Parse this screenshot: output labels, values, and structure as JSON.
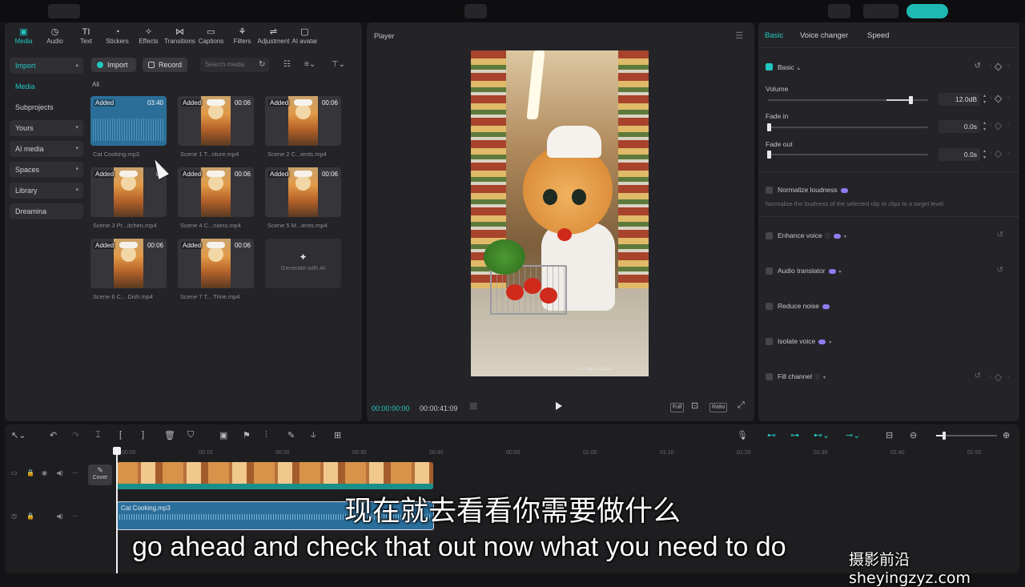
{
  "media_tools": [
    {
      "label": "Media",
      "icon": "media-icon",
      "glyph": "▣",
      "active": true
    },
    {
      "label": "Audio",
      "icon": "audio-icon",
      "glyph": "◷"
    },
    {
      "label": "Text",
      "icon": "text-icon",
      "glyph": "TI"
    },
    {
      "label": "Stickers",
      "icon": "stickers-icon",
      "glyph": "◔"
    },
    {
      "label": "Effects",
      "icon": "effects-icon",
      "glyph": "✧"
    },
    {
      "label": "Transitions",
      "icon": "transitions-icon",
      "glyph": "⋈"
    },
    {
      "label": "Captions",
      "icon": "captions-icon",
      "glyph": "▭"
    },
    {
      "label": "Filters",
      "icon": "filters-icon",
      "glyph": "⚘"
    },
    {
      "label": "Adjustment",
      "icon": "adjustment-icon",
      "glyph": "⇌"
    },
    {
      "label": "AI avatar",
      "icon": "ai-avatar-icon",
      "glyph": "▢"
    }
  ],
  "sidebar": [
    {
      "label": "Import",
      "boxed": true,
      "caret": true,
      "green": true
    },
    {
      "label": "Media",
      "green": true
    },
    {
      "label": "Subprojects"
    },
    {
      "label": "Yours",
      "boxed": true,
      "caret": true
    },
    {
      "label": "AI media",
      "boxed": true,
      "caret": true
    },
    {
      "label": "Spaces",
      "boxed": true,
      "caret": true
    },
    {
      "label": "Library",
      "boxed": true,
      "caret": true
    },
    {
      "label": "Dreamina",
      "boxed": true
    }
  ],
  "media_toolbar": {
    "import_label": "Import",
    "record_label": "Record",
    "search_placeholder": "Search media"
  },
  "all_label": "All",
  "media_items": [
    {
      "name": "Cat Cooking.mp3",
      "badge": "Added",
      "duration": "03:40",
      "type": "audio"
    },
    {
      "name": "Scene 1 T...nture.mp4",
      "badge": "Added",
      "duration": "00:06",
      "type": "video"
    },
    {
      "name": "Scene 2 C...ients.mp4",
      "badge": "Added",
      "duration": "00:06",
      "type": "video"
    },
    {
      "name": "Scene 3 Pr...itchen.mp4",
      "badge": "Added",
      "duration": "00",
      "type": "video"
    },
    {
      "name": "Scene 4 C...nions.mp4",
      "badge": "Added",
      "duration": "00:06",
      "type": "video"
    },
    {
      "name": "Scene 5 M...ients.mp4",
      "badge": "Added",
      "duration": "00:06",
      "type": "video"
    },
    {
      "name": "Scene 6 C... Dish.mp4",
      "badge": "Added",
      "duration": "00:06",
      "type": "video"
    },
    {
      "name": "Scene 7 T... Time.mp4",
      "badge": "Added",
      "duration": "00:06",
      "type": "video"
    }
  ],
  "generate_label": "Generate with AI",
  "player": {
    "title": "Player",
    "current_time": "00:00:00:00",
    "total_time": "00:00:41:09",
    "full_label": "Full",
    "ratio_label": "Ratio",
    "watermark": "♪ TikTok ▶ CapCut"
  },
  "props": {
    "tabs": [
      {
        "label": "Basic",
        "active": true
      },
      {
        "label": "Voice changer"
      },
      {
        "label": "Speed"
      }
    ],
    "basic_label": "Basic",
    "volume_label": "Volume",
    "volume_value": "12.0dB",
    "volume_level": 0.89,
    "fade_in_label": "Fade in",
    "fade_in_value": "0.0s",
    "fade_out_label": "Fade out",
    "fade_out_value": "0.0s",
    "normalize_label": "Normalize loudness",
    "normalize_desc": "Normalize the loudness of the selected clip or clips to a target level.",
    "enhance_label": "Enhance voice",
    "translator_label": "Audio translator",
    "reduce_label": "Reduce noise",
    "isolate_label": "Isolate voice",
    "fill_label": "Fill channel"
  },
  "timeline": {
    "ticks": [
      "00:00",
      "00:10",
      "00:20",
      "00:30",
      "00:40",
      "00:50",
      "01:00",
      "01:10",
      "01:20",
      "01:30",
      "01:40",
      "01:50"
    ],
    "cover_label": "Cover",
    "audio_clip_label": "Cat Cooking.mp3",
    "zoom_level": 0.13
  },
  "subtitles": {
    "zh": "现在就去看看你需要做什么",
    "en": "go ahead and check that out now what you need to do"
  },
  "watermark": "摄影前沿 sheyingzyz.com",
  "colors": {
    "accent": "#22c7c1",
    "panel": "#242428",
    "background": "#141416",
    "audio_clip": "#2a6f9c"
  }
}
